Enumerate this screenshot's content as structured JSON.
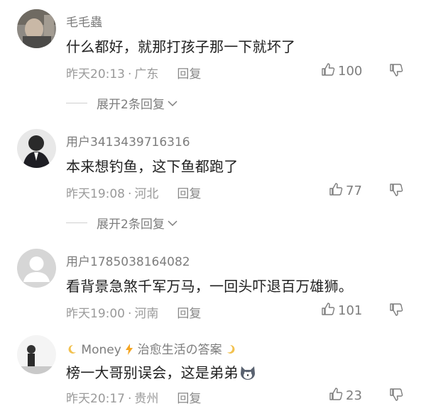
{
  "comments": [
    {
      "username": "毛毛蟲",
      "text": "什么都好，就那打孩子那一下就坏了",
      "time": "昨天20:13",
      "location": "广东",
      "reply_label": "回复",
      "likes": "100",
      "expand_label": "展开2条回复",
      "avatar": "photo-avatar"
    },
    {
      "username": "用户3413439716316",
      "text": "本来想钓鱼，这下鱼都跑了",
      "time": "昨天19:08",
      "location": "河北",
      "reply_label": "回复",
      "likes": "77",
      "expand_label": "展开2条回复",
      "avatar": "photo-avatar"
    },
    {
      "username": "用户1785038164082",
      "text": "看背景急煞千军万马，一回头吓退百万雄狮。",
      "time": "昨天19:00",
      "location": "河南",
      "reply_label": "回复",
      "likes": "101",
      "avatar": "default-user-avatar"
    },
    {
      "username_prefix_icon": "crescent-moon-icon",
      "username": "Money",
      "username_mid_icon": "lightning-icon",
      "username_suffix": "治愈生活の答案",
      "username_end_icon": "crescent-moon-icon",
      "text": "榜一大哥别误会，这是弟弟",
      "text_emoji": "dog-face-emoji",
      "time": "昨天20:17",
      "location": "贵州",
      "reply_label": "回复",
      "likes": "23",
      "avatar": "photo-avatar"
    }
  ],
  "meta_separator": "·",
  "colors": {
    "text": "#1f1f1f",
    "secondary": "#7d7d7d",
    "muted": "#9a9a9a",
    "moon": "#f2c14e",
    "bolt": "#f5a623"
  }
}
